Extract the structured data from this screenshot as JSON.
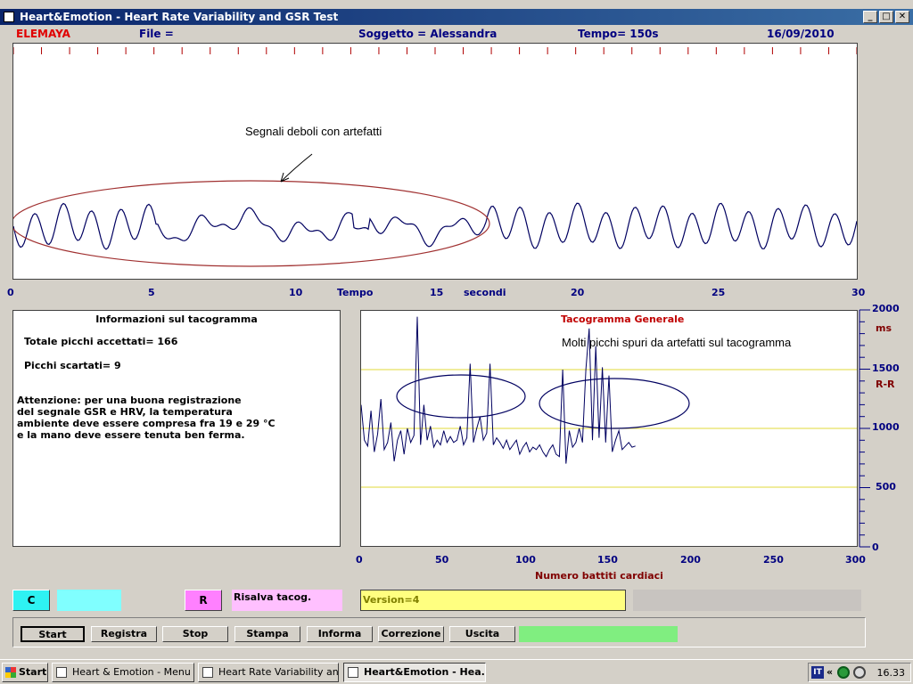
{
  "window": {
    "title": "Heart&Emotion -  Heart Rate Variability and GSR Test",
    "minimize": "_",
    "maximize": "□",
    "close": "✕"
  },
  "infobar": {
    "brand": "ELEMAYA",
    "file": "File  =",
    "subject": "Soggetto = Alessandra",
    "time": "Tempo=  150s",
    "date": "16/09/2010",
    "brand_color": "#e00000",
    "text_color": "#000080"
  },
  "signal_chart": {
    "annotation": "Segnali deboli con artefatti",
    "x_ticks": [
      "0",
      "5",
      "10",
      "15",
      "20",
      "25",
      "30"
    ],
    "x_label_left": "Tempo",
    "x_label_right": "secondi",
    "line_color": "#000060",
    "highlight_color": "#a03030"
  },
  "info_panel": {
    "title": "Informazioni sul tacogramma",
    "accepted": "Totale picchi accettati= 166",
    "discarded": "Picchi scartati= 9",
    "warning_lines": [
      "Attenzione: per una buona registrazione",
      "del segnale GSR e HRV, la temperatura",
      "ambiente deve essere compresa fra 19 e 29 °C",
      "e la mano deve essere tenuta ben ferma."
    ]
  },
  "chart_data": {
    "type": "line",
    "title": "Tacogramma Generale",
    "annotation": "Molti picchi spuri da artefatti sul tacogramma",
    "xlabel": "Numero battiti cardiaci",
    "ylabel": "R-R",
    "y_unit": "ms",
    "xlim": [
      0,
      300
    ],
    "ylim": [
      0,
      2000
    ],
    "x_ticks": [
      "0",
      "50",
      "100",
      "150",
      "200",
      "250",
      "300"
    ],
    "y_ticks": [
      "2000",
      "1500",
      "1000",
      "500",
      "0"
    ],
    "reference_lines": [
      1500,
      1000,
      500
    ],
    "series": [
      {
        "x": [
          0,
          2,
          4,
          6,
          8,
          10,
          12,
          14,
          16,
          18,
          20,
          22,
          24,
          26,
          28,
          30,
          32,
          34,
          36,
          38,
          40,
          42,
          44,
          46,
          48,
          50,
          52,
          54,
          56,
          58,
          60,
          62,
          64,
          66,
          68,
          70,
          72,
          74,
          76,
          78,
          80,
          82,
          84,
          86,
          88,
          90,
          92,
          94,
          96,
          98,
          100,
          102,
          104,
          106,
          108,
          110,
          112,
          114,
          116,
          118,
          120,
          122,
          124,
          126,
          128,
          130,
          132,
          134,
          136,
          138,
          140,
          142,
          144,
          146,
          148,
          150,
          152,
          154,
          156,
          158,
          160,
          162,
          164,
          166
        ],
        "y": [
          1200,
          900,
          850,
          1150,
          800,
          950,
          1250,
          820,
          880,
          1050,
          720,
          900,
          980,
          780,
          1000,
          880,
          940,
          1950,
          860,
          1200,
          900,
          1020,
          840,
          900,
          860,
          980,
          880,
          930,
          880,
          900,
          1020,
          860,
          920,
          1550,
          880,
          1000,
          1100,
          900,
          960,
          1550,
          860,
          920,
          880,
          830,
          900,
          820,
          860,
          900,
          780,
          840,
          880,
          800,
          840,
          820,
          860,
          800,
          760,
          820,
          860,
          780,
          760,
          1500,
          700,
          980,
          840,
          880,
          1000,
          880,
          1500,
          1850,
          900,
          1700,
          920,
          1520,
          880,
          1450,
          800,
          900,
          980,
          820,
          850,
          880,
          840,
          850
        ],
        "color": "#000060"
      }
    ]
  },
  "controls": {
    "c_label": "C",
    "r_label": "R",
    "r_field": "Risalva tacog.",
    "version": "Version=4",
    "buttons": [
      "Start",
      "Registra",
      "Stop",
      "Stampa",
      "Informa",
      "Correzione",
      "Uscita"
    ]
  },
  "taskbar": {
    "start": "Start",
    "tasks": [
      "Heart & Emotion - Menu",
      "Heart Rate Variability an...",
      "Heart&Emotion -  Hea..."
    ],
    "lang": "IT",
    "chevron": "«",
    "clock": "16.33"
  }
}
